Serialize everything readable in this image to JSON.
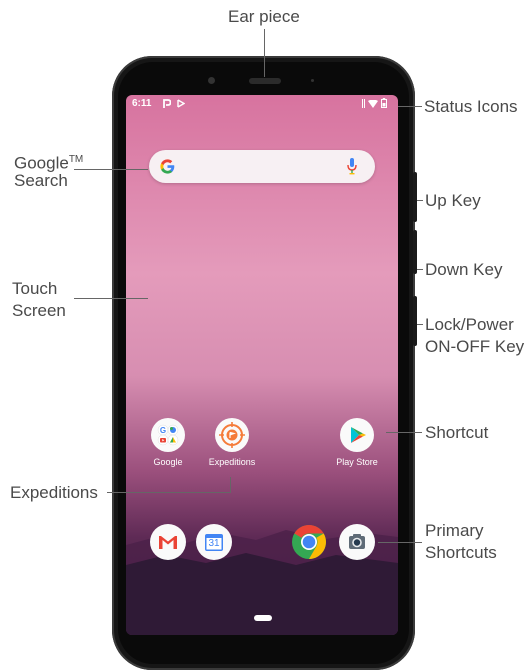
{
  "labels": {
    "ear_piece": "Ear piece",
    "status_icons": "Status Icons",
    "google_search_line1": "Google",
    "google_search_tm": "TM",
    "google_search_line2": "Search",
    "up_key": "Up Key",
    "down_key": "Down Key",
    "touch_screen_line1": "Touch",
    "touch_screen_line2": "Screen",
    "lock_power_line1": "Lock/Power",
    "lock_power_line2": "ON-OFF Key",
    "shortcut": "Shortcut",
    "expeditions": "Expeditions",
    "primary_shortcuts_line1": "Primary",
    "primary_shortcuts_line2": "Shortcuts"
  },
  "phone": {
    "status_time": "6:11",
    "apps": [
      {
        "label": "Google",
        "icon": "google-folder-icon"
      },
      {
        "label": "Expeditions",
        "icon": "expeditions-icon"
      },
      {
        "label": "Play Store",
        "icon": "play-store-icon"
      }
    ],
    "dock": [
      {
        "icon": "gmail-icon"
      },
      {
        "icon": "calendar-icon",
        "text": "31"
      },
      {
        "icon": "chrome-icon"
      },
      {
        "icon": "camera-icon"
      }
    ]
  },
  "colors": {
    "label_text": "#4a4a4a",
    "screen_top": "#d7739f",
    "screen_bottom": "#3c1d40"
  }
}
